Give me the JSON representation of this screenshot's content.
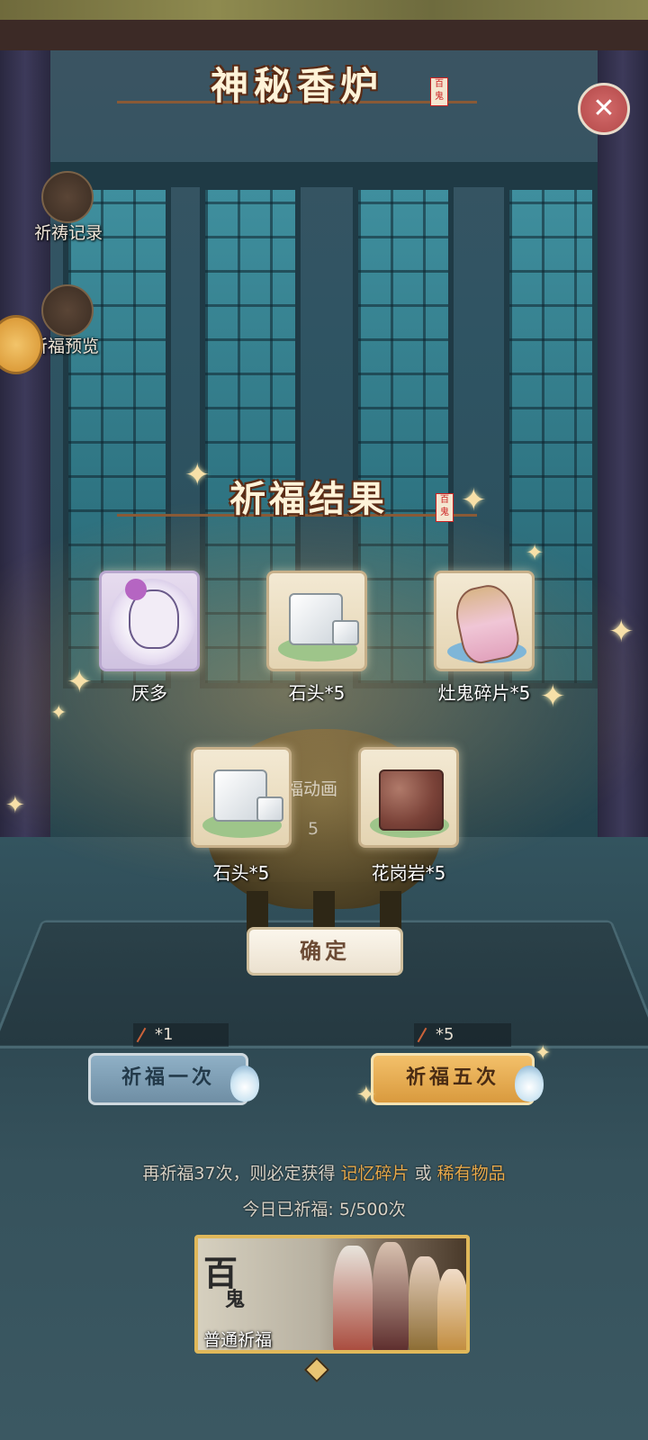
{
  "header": {
    "title": "神秘香炉",
    "seal": "百鬼"
  },
  "sidebar": {
    "record_label": "祈祷记录",
    "preview_label": "祈福预览"
  },
  "result": {
    "title": "祈福结果",
    "seal": "百鬼",
    "items": [
      {
        "name": "厌多",
        "icon": "character-portrait"
      },
      {
        "name": "石头*5",
        "icon": "stone-icon"
      },
      {
        "name": "灶鬼碎片*5",
        "icon": "ghost-fragment-icon"
      },
      {
        "name": "石头*5",
        "icon": "stone-icon"
      },
      {
        "name": "花岗岩*5",
        "icon": "granite-icon"
      }
    ],
    "confirm_label": "确定"
  },
  "background": {
    "partial_text": "福动画",
    "partial_number": "5"
  },
  "pray": {
    "once_cost": "*1",
    "five_cost": "*5",
    "once_label": "祈福一次",
    "five_label": "祈福五次"
  },
  "info": {
    "prefix": "再祈福37次，则必定获得",
    "reward1": "记忆碎片",
    "or": "或",
    "reward2": "稀有物品",
    "today": "今日已祈福: 5/500次"
  },
  "banner": {
    "char1": "百",
    "char2": "鬼",
    "label": "普通祈福"
  },
  "colors": {
    "highlight": "#e7a94b",
    "five_button": "#d99a3e",
    "once_button": "#6f8ea4"
  }
}
